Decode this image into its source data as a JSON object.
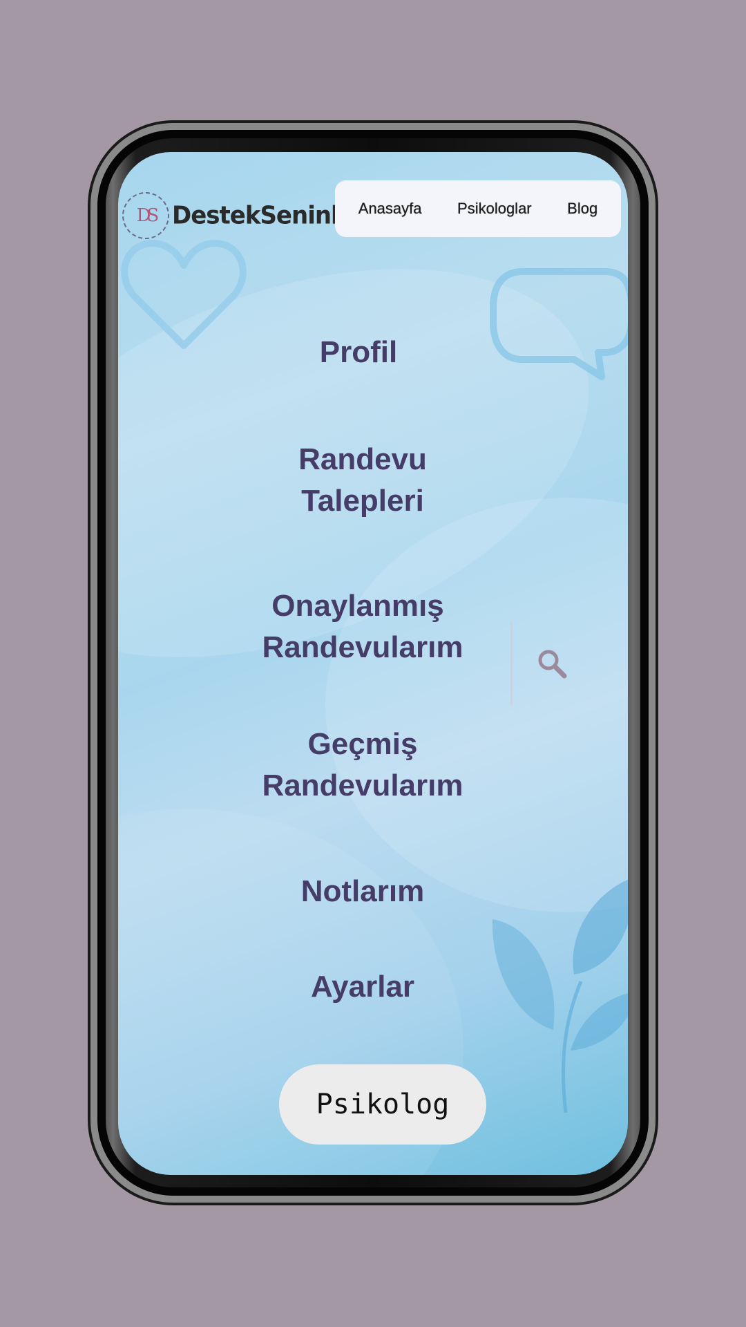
{
  "brand": {
    "name": "DestekSeninle",
    "monogram": "DS"
  },
  "nav": {
    "items": [
      "Anasayfa",
      "Psikologlar",
      "Blog"
    ]
  },
  "menu": {
    "items": [
      {
        "line1": "Profil",
        "line2": ""
      },
      {
        "line1": "Randevu",
        "line2": "Talepleri"
      },
      {
        "line1": "Onaylanmış",
        "line2": "Randevularım"
      },
      {
        "line1": "Geçmiş",
        "line2": "Randevularım"
      },
      {
        "line1": "Notlarım",
        "line2": ""
      },
      {
        "line1": "Ayarlar",
        "line2": ""
      }
    ]
  },
  "role_button": {
    "label": "Psikolog"
  },
  "colors": {
    "page_background": "#a498a5",
    "menu_text": "#463c68",
    "nav_background": "#f4f5fb",
    "button_background": "#ececec"
  },
  "icons": {
    "search": "search-icon",
    "heart": "heart-icon",
    "chat": "chat-bubble-icon",
    "leaves": "leaves-icon"
  }
}
